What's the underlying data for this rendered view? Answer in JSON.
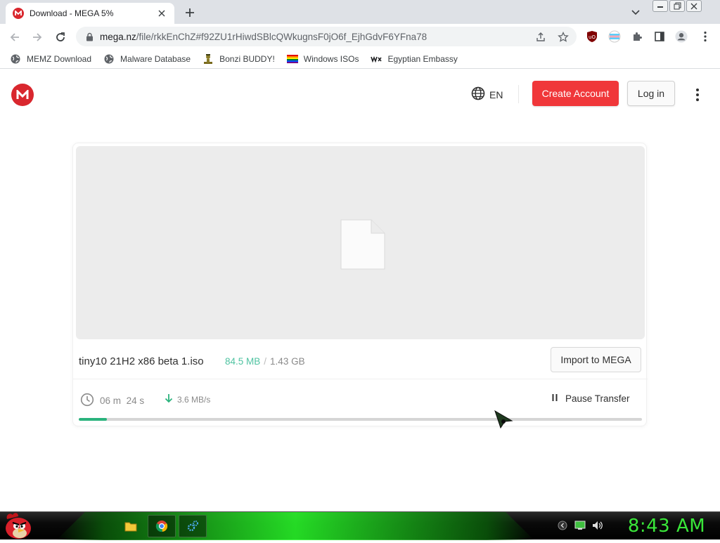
{
  "browser": {
    "tab": {
      "title": "Download - MEGA 5%",
      "favicon": "mega-icon"
    },
    "url": {
      "host": "mega.nz",
      "path": "/file/rkkEnChZ#f92ZU1rHiwdSBlcQWkugnsF0jO6f_EjhGdvF6YFna78"
    },
    "bookmarks": [
      {
        "label": "MEMZ Download",
        "icon": "globe-icon"
      },
      {
        "label": "Malware Database",
        "icon": "globe-icon"
      },
      {
        "label": "Bonzi BUDDY!",
        "icon": "bonzi-icon"
      },
      {
        "label": "Windows ISOs",
        "icon": "rainbow-flag-icon"
      },
      {
        "label": "Egyptian Embassy",
        "icon": "wix-icon"
      }
    ]
  },
  "mega": {
    "language": "EN",
    "create_account": "Create Account",
    "login": "Log in"
  },
  "download": {
    "file_name": "tiny10 21H2 x86 beta 1.iso",
    "downloaded": "84.5 MB",
    "separator": "/",
    "total": "1.43 GB",
    "import_label": "Import to MEGA",
    "time_minutes": "06",
    "time_minutes_unit": "m",
    "time_seconds": "24",
    "time_seconds_unit": "s",
    "speed": "3.6 MB/s",
    "pause_label": "Pause Transfer",
    "progress_percent": 5
  },
  "taskbar": {
    "clock": "8:43 AM",
    "apps": [
      "folder-icon",
      "chrome-icon",
      "settings-icon"
    ]
  },
  "colors": {
    "mega_red": "#d9272e",
    "create_button": "#f0373a",
    "progress": "#2bb37d",
    "downloaded_text": "#4fc3a1",
    "clock_green": "#39e639"
  }
}
